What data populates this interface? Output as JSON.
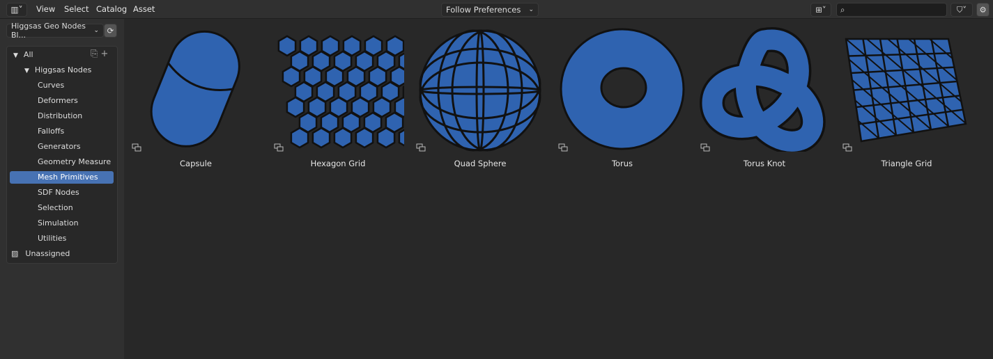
{
  "menu": {
    "items": [
      "View",
      "Select",
      "Catalog",
      "Asset"
    ]
  },
  "header": {
    "import_method": "Follow Preferences",
    "search_placeholder": ""
  },
  "library": {
    "selected": "Higgsas Geo Nodes Bl..."
  },
  "catalog": {
    "all": "All",
    "root": "Higgsas Nodes",
    "children": [
      "Curves",
      "Deformers",
      "Distribution",
      "Falloffs",
      "Generators",
      "Geometry Measure",
      "Mesh Primitives",
      "SDF Nodes",
      "Selection",
      "Simulation",
      "Utilities"
    ],
    "selected": "Mesh Primitives",
    "unassigned": "Unassigned"
  },
  "assets": [
    {
      "name": "Capsule",
      "shape": "capsule"
    },
    {
      "name": "Hexagon Grid",
      "shape": "hexgrid"
    },
    {
      "name": "Quad Sphere",
      "shape": "sphere"
    },
    {
      "name": "Torus",
      "shape": "torus"
    },
    {
      "name": "Torus Knot",
      "shape": "knot"
    },
    {
      "name": "Triangle Grid",
      "shape": "trigrid"
    }
  ],
  "colors": {
    "accent": "#4772b3",
    "asset_blue": "#2f63b0"
  }
}
